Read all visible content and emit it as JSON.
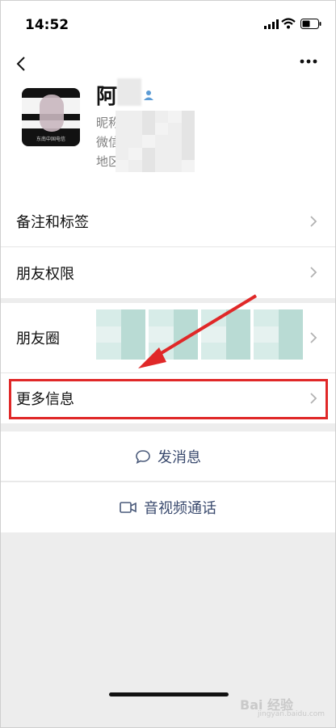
{
  "status_bar": {
    "time": "14:52"
  },
  "header": {
    "back_icon": "chevron-left-icon",
    "more_icon": "ellipsis-icon",
    "name": "阿",
    "nickname_label": "昵称",
    "wechat_id_label": "微信",
    "region_label": "地区",
    "avatar_caption": "东南中国电信"
  },
  "menu": {
    "remark_tags": "备注和标签",
    "friend_permissions": "朋友权限",
    "moments": "朋友圈",
    "more_info": "更多信息"
  },
  "actions": {
    "send_message": "发消息",
    "video_call": "音视频通话"
  },
  "watermark": {
    "text": "Bai 经验",
    "sub": "jingyan.baidu.com"
  },
  "colors": {
    "highlight": "#e02828",
    "action_text": "#3a4a6e"
  }
}
